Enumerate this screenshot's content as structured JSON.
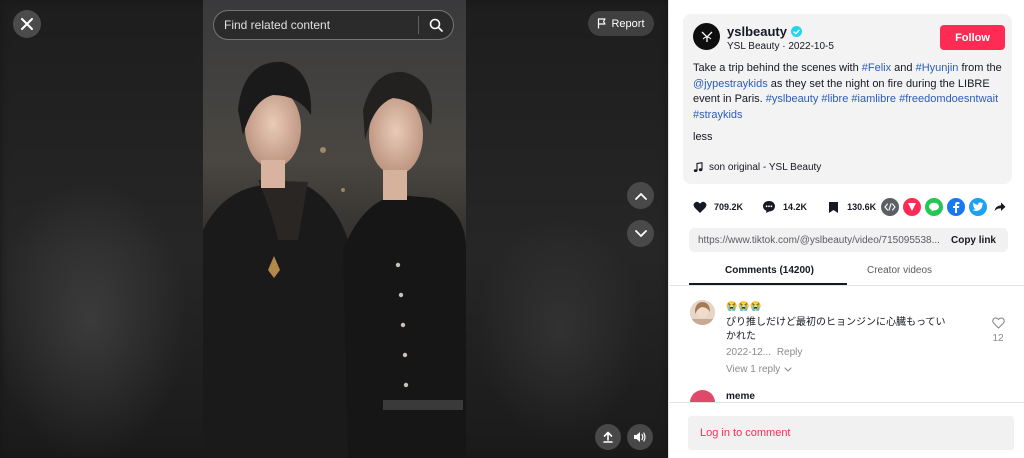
{
  "search": {
    "placeholder": "Find related content"
  },
  "report": {
    "label": "Report"
  },
  "author": {
    "username": "yslbeauty",
    "display_name": "YSL Beauty",
    "separator": " · ",
    "date": "2022-10-5",
    "follow_label": "Follow"
  },
  "caption": {
    "part1": "Take a trip behind the scenes with ",
    "tag1": "#Felix",
    "part2": " and ",
    "tag2": "#Hyunjin",
    "part3": " from the ",
    "tag3": "@jypestraykids",
    "part4": " as they set the night on fire during the LIBRE event in Paris. ",
    "tag4": "#yslbeauty",
    "sp1": " ",
    "tag5": "#libre",
    "sp2": " ",
    "tag6": "#iamlibre",
    "sp3": " ",
    "tag7": "#freedomdoesntwait",
    "sp4": " ",
    "tag8": "#straykids",
    "less_label": "less"
  },
  "music": {
    "label": "son original - YSL Beauty"
  },
  "stats": {
    "likes": "709.2K",
    "comments": "14.2K",
    "bookmarks": "130.6K"
  },
  "link": {
    "url": "https://www.tiktok.com/@yslbeauty/video/715095538...",
    "copy_label": "Copy link"
  },
  "tabs": {
    "comments": "Comments (14200)",
    "creator": "Creator videos"
  },
  "comments": [
    {
      "emoji": "😭😭😭",
      "text": "ぴり推しだけど最初のヒョンジンに心臓もっていかれた",
      "date": "2022-12...",
      "reply_label": "Reply",
      "likes": "12",
      "view_replies": "View 1 reply"
    },
    {
      "username": "meme"
    }
  ],
  "login": {
    "label": "Log in to comment"
  },
  "colors": {
    "accent": "#fe2c55",
    "hashtag": "#2b5db9",
    "verified": "#20d5ec"
  },
  "icons": {
    "close": "close-icon",
    "search": "search-icon",
    "flag": "flag-icon",
    "up": "chevron-up-icon",
    "down": "chevron-down-icon",
    "mute": "volume-icon",
    "upload": "upload-icon"
  }
}
